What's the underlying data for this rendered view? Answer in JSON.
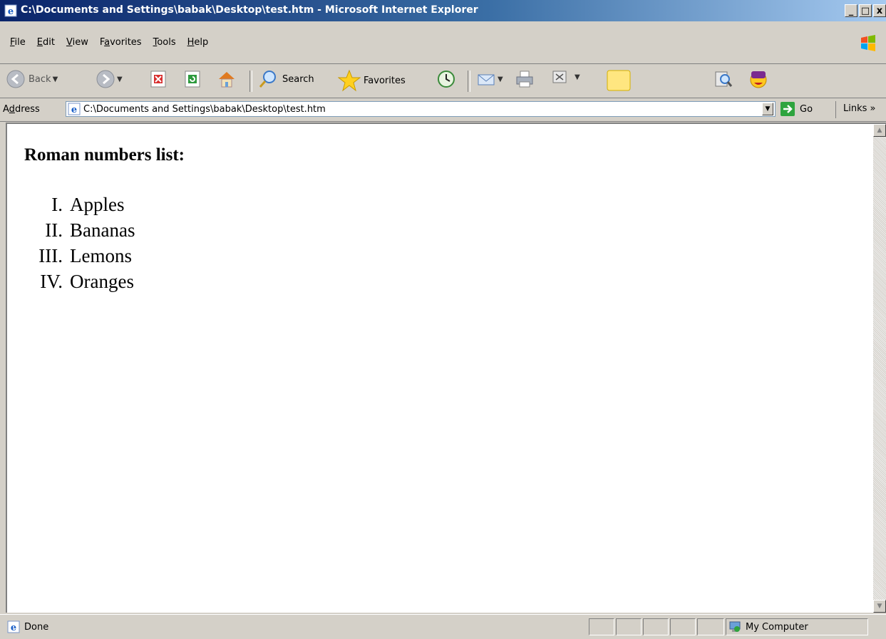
{
  "window": {
    "title": "C:\\Documents and Settings\\babak\\Desktop\\test.htm - Microsoft Internet Explorer",
    "controls": [
      "_",
      "□",
      "x"
    ]
  },
  "menubar": {
    "items": [
      {
        "label": "File",
        "underline": "F",
        "rest": "ile"
      },
      {
        "label": "Edit",
        "underline": "E",
        "rest": "dit"
      },
      {
        "label": "View",
        "underline": "V",
        "rest": "iew"
      },
      {
        "label": "Favorites",
        "underline_pre": "F",
        "underline": "a",
        "rest": "vorites"
      },
      {
        "label": "Tools",
        "underline": "T",
        "rest": "ools"
      },
      {
        "label": "Help",
        "underline": "H",
        "rest": "elp"
      }
    ]
  },
  "toolbar": {
    "back_label": "Back",
    "search_label": "Search",
    "favorites_label": "Favorites"
  },
  "address": {
    "label_pre": "A",
    "label_underline": "d",
    "label_rest": "dress",
    "url": "C:\\Documents and Settings\\babak\\Desktop\\test.htm",
    "go_label": "Go",
    "links_label": "Links »"
  },
  "page": {
    "heading": "Roman numbers list:",
    "items": [
      {
        "num": "I.",
        "text": "Apples"
      },
      {
        "num": "II.",
        "text": "Bananas"
      },
      {
        "num": "III.",
        "text": "Lemons"
      },
      {
        "num": "IV.",
        "text": "Oranges"
      }
    ]
  },
  "status": {
    "left": "Done",
    "zone": "My Computer"
  }
}
